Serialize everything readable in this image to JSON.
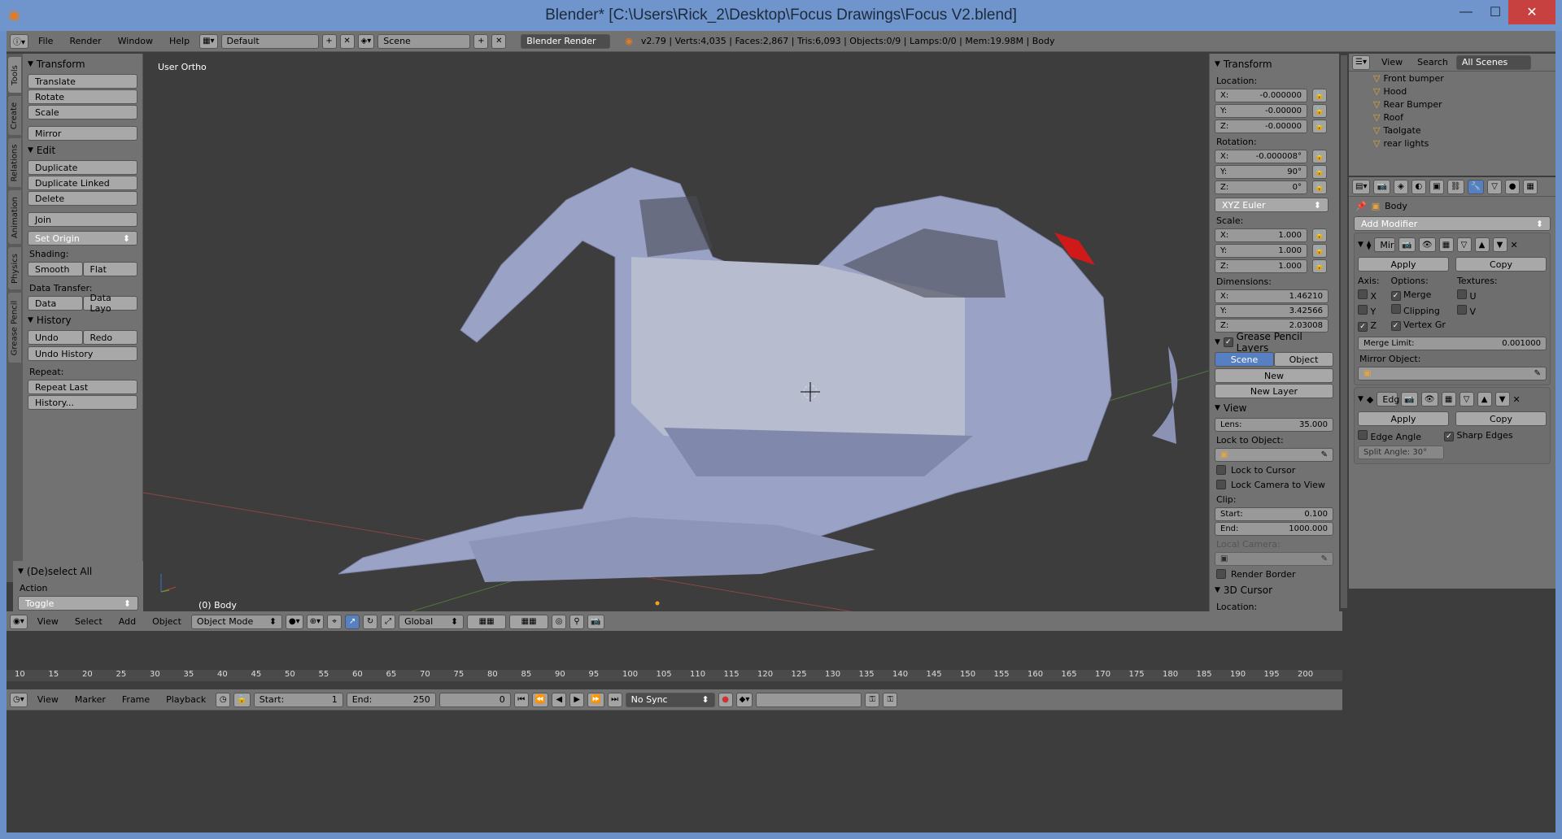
{
  "window": {
    "title": "Blender* [C:\\Users\\Rick_2\\Desktop\\Focus Drawings\\Focus V2.blend]",
    "minimize": "—",
    "maximize": "☐",
    "close": "✕"
  },
  "topbar": {
    "menus": [
      "File",
      "Render",
      "Window",
      "Help"
    ],
    "layout": "Default",
    "scene": "Scene",
    "engine": "Blender Render",
    "info": "v2.79 | Verts:4,035 | Faces:2,867 | Tris:6,093 | Objects:0/9 | Lamps:0/0 | Mem:19.98M | Body"
  },
  "tool_tabs": [
    "Tools",
    "Create",
    "Relations",
    "Animation",
    "Physics",
    "Grease Pencil"
  ],
  "tools": {
    "transform": {
      "title": "Transform",
      "buttons": [
        "Translate",
        "Rotate",
        "Scale"
      ],
      "mirror": "Mirror"
    },
    "edit": {
      "title": "Edit",
      "buttons": [
        "Duplicate",
        "Duplicate Linked",
        "Delete"
      ],
      "join": "Join",
      "set_origin": "Set Origin",
      "shading_label": "Shading:",
      "smooth": "Smooth",
      "flat": "Flat",
      "data_transfer_label": "Data Transfer:",
      "data": "Data",
      "data_layo": "Data Layo"
    },
    "history": {
      "title": "History",
      "undo": "Undo",
      "redo": "Redo",
      "undo_history": "Undo History",
      "repeat_label": "Repeat:",
      "repeat_last": "Repeat Last",
      "history_btn": "History..."
    },
    "deselect": {
      "title": "(De)select All",
      "action_label": "Action",
      "action_value": "Toggle"
    }
  },
  "viewport": {
    "label": "User Ortho",
    "object": "(0) Body"
  },
  "npanel": {
    "transform_title": "Transform",
    "location_label": "Location:",
    "location": [
      "X:",
      "-0.000000",
      "Y:",
      "-0.00000",
      "Z:",
      "-0.00000"
    ],
    "rotation_label": "Rotation:",
    "rotation": [
      "X:",
      "-0.000008°",
      "Y:",
      "90°",
      "Z:",
      "0°"
    ],
    "rotation_mode": "XYZ Euler",
    "scale_label": "Scale:",
    "scale": [
      "X:",
      "1.000",
      "Y:",
      "1.000",
      "Z:",
      "1.000"
    ],
    "dimensions_label": "Dimensions:",
    "dimensions": [
      "X:",
      "1.46210",
      "Y:",
      "3.42566",
      "Z:",
      "2.03008"
    ],
    "gp_title": "Grease Pencil Layers",
    "gp_scene": "Scene",
    "gp_object": "Object",
    "gp_new": "New",
    "gp_new_layer": "New Layer",
    "view_title": "View",
    "lens_label": "Lens:",
    "lens": "35.000",
    "lock_obj": "Lock to Object:",
    "lock_cursor": "Lock to Cursor",
    "lock_cam": "Lock Camera to View",
    "clip_label": "Clip:",
    "clip_start_label": "Start:",
    "clip_start": "0.100",
    "clip_end_label": "End:",
    "clip_end": "1000.000",
    "local_cam": "Local Camera:",
    "render_border": "Render Border",
    "cursor_title": "3D Cursor",
    "cursor_loc": "Location:"
  },
  "outliner": {
    "view": "View",
    "search": "Search",
    "scenes": "All Scenes",
    "items": [
      "Front bumper",
      "Hood",
      "Rear Bumper",
      "Roof",
      "Taolgate",
      "rear lights"
    ]
  },
  "properties": {
    "object": "Body",
    "add_modifier": "Add Modifier",
    "mirror": {
      "name": "Mir",
      "apply": "Apply",
      "copy": "Copy",
      "axis": "Axis:",
      "options": "Options:",
      "textures": "Textures:",
      "x": "X",
      "y": "Y",
      "z": "Z",
      "merge": "Merge",
      "clipping": "Clipping",
      "vertex": "Vertex Gr",
      "u": "U",
      "v": "V",
      "merge_limit_label": "Merge Limit:",
      "merge_limit": "0.001000",
      "mirror_obj": "Mirror Object:"
    },
    "edge": {
      "name": "Edg",
      "apply": "Apply",
      "copy": "Copy",
      "edge_angle": "Edge Angle",
      "sharp_edges": "Sharp Edges",
      "split_angle": "Split Angle: 30°"
    }
  },
  "bottom_header": {
    "menus": [
      "View",
      "Select",
      "Add",
      "Object"
    ],
    "mode": "Object Mode",
    "orientation": "Global"
  },
  "timeline": {
    "ticks": [
      "10",
      "15",
      "20",
      "25",
      "30",
      "35",
      "40",
      "45",
      "50",
      "55",
      "60",
      "65",
      "70",
      "75",
      "80",
      "85",
      "90",
      "95",
      "100",
      "105",
      "110",
      "115",
      "120",
      "125",
      "130",
      "135",
      "140",
      "145",
      "150",
      "155",
      "160",
      "165",
      "170",
      "175",
      "180",
      "185",
      "190",
      "195",
      "200"
    ],
    "menus": [
      "View",
      "Marker",
      "Frame",
      "Playback"
    ],
    "start_label": "Start:",
    "start": "1",
    "end_label": "End:",
    "end": "250",
    "current": "0",
    "sync": "No Sync"
  }
}
